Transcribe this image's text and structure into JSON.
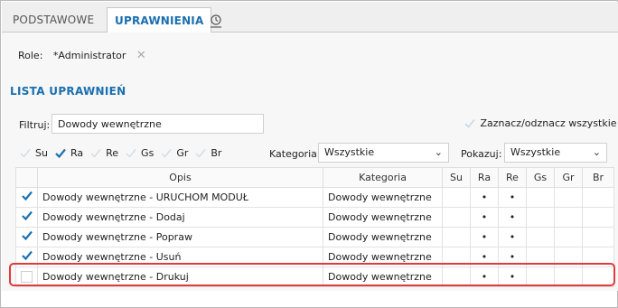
{
  "tabs": [
    {
      "label": "PODSTAWOWE"
    },
    {
      "label": "UPRAWNIENIA"
    }
  ],
  "history_icon": "history-icon",
  "role": {
    "label": "Role:",
    "value": "*Administrator"
  },
  "section_title": "LISTA UPRAWNIEŃ",
  "filter": {
    "label": "Filtruj:",
    "value": "Dowody wewnętrzne"
  },
  "select_all_label": "Zaznacz/odznacz wszystkie",
  "flags": [
    {
      "label": "Su",
      "checked": false
    },
    {
      "label": "Ra",
      "checked": true
    },
    {
      "label": "Re",
      "checked": false
    },
    {
      "label": "Gs",
      "checked": false
    },
    {
      "label": "Gr",
      "checked": false
    },
    {
      "label": "Br",
      "checked": false
    }
  ],
  "kategoria": {
    "label": "Kategoria:",
    "value": "Wszystkie"
  },
  "pokazuj": {
    "label": "Pokazuj:",
    "value": "Wszystkie"
  },
  "columns": [
    "",
    "Opis",
    "Kategoria",
    "Su",
    "Ra",
    "Re",
    "Gs",
    "Gr",
    "Br"
  ],
  "rows": [
    {
      "checked": true,
      "opis": "Dowody wewnętrzne - URUCHOM MODUŁ",
      "kategoria": "Dowody wewnętrzne",
      "su": "",
      "ra": "•",
      "re": "•",
      "gs": "",
      "gr": "",
      "br": ""
    },
    {
      "checked": true,
      "opis": "Dowody wewnętrzne - Dodaj",
      "kategoria": "Dowody wewnętrzne",
      "su": "",
      "ra": "•",
      "re": "•",
      "gs": "",
      "gr": "",
      "br": ""
    },
    {
      "checked": true,
      "opis": "Dowody wewnętrzne - Popraw",
      "kategoria": "Dowody wewnętrzne",
      "su": "",
      "ra": "•",
      "re": "•",
      "gs": "",
      "gr": "",
      "br": ""
    },
    {
      "checked": true,
      "opis": "Dowody wewnętrzne - Usuń",
      "kategoria": "Dowody wewnętrzne",
      "su": "",
      "ra": "•",
      "re": "•",
      "gs": "",
      "gr": "",
      "br": ""
    },
    {
      "checked": false,
      "opis": "Dowody wewnętrzne - Drukuj",
      "kategoria": "Dowody wewnętrzne",
      "su": "",
      "ra": "•",
      "re": "•",
      "gs": "",
      "gr": "",
      "br": ""
    }
  ],
  "colors": {
    "accent": "#1a6fb0",
    "check": "#1a6fb0",
    "highlight": "#e03a3a"
  }
}
